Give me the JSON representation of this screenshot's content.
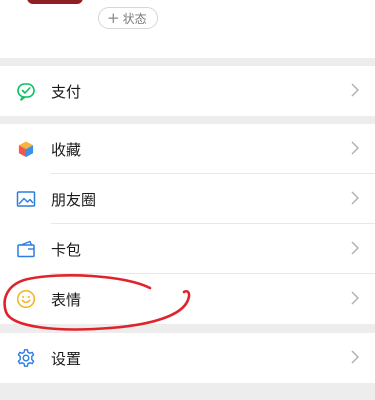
{
  "profile": {
    "status_button": {
      "plus": "+",
      "label": "状态"
    }
  },
  "menu_groups": [
    {
      "items": [
        {
          "key": "pay",
          "label": "支付",
          "icon": "wechat-pay-icon"
        }
      ]
    },
    {
      "items": [
        {
          "key": "favorites",
          "label": "收藏",
          "icon": "favorites-cube-icon"
        },
        {
          "key": "moments",
          "label": "朋友圈",
          "icon": "picture-icon"
        },
        {
          "key": "cards",
          "label": "卡包",
          "icon": "card-wallet-icon"
        },
        {
          "key": "stickers",
          "label": "表情",
          "icon": "smiley-icon"
        }
      ]
    },
    {
      "items": [
        {
          "key": "settings",
          "label": "设置",
          "icon": "gear-icon"
        }
      ]
    }
  ],
  "colors": {
    "background": "#ededed",
    "pay_green": "#07c160",
    "annotation_red": "#e0232b"
  }
}
